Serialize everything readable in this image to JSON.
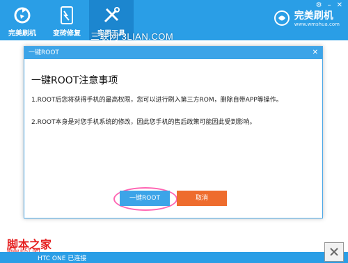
{
  "nav": {
    "tabs": [
      {
        "label": "完美刷机",
        "icon": "refresh-icon"
      },
      {
        "label": "变砖修复",
        "icon": "phone-icon"
      },
      {
        "label": "实用工具",
        "icon": "tools-icon",
        "active": true
      }
    ]
  },
  "brand": {
    "name": "完美刷机",
    "url": "www.wmshua.com"
  },
  "watermark_top": "三联网 3LIAN.COM",
  "dialog": {
    "title": "一键ROOT",
    "heading": "一键ROOT注意事项",
    "p1": "1.ROOT后您将获得手机的最高权限，您可以进行刷入第三方ROM，删除自带APP等操作。",
    "p2": "2.ROOT本身是对您手机系统的修改，因此您手机的售后政策可能因此受到影响。",
    "ok_label": "一键ROOT",
    "cancel_label": "取消"
  },
  "bottom_watermark": {
    "title": "脚本之家",
    "url": "www.jb51.net"
  },
  "status": {
    "text": "HTC ONE 已连接"
  },
  "colors": {
    "primary": "#2a9ee6",
    "cancel": "#ee6c2d",
    "highlight": "#ff66b3",
    "watermark": "#e52020"
  }
}
